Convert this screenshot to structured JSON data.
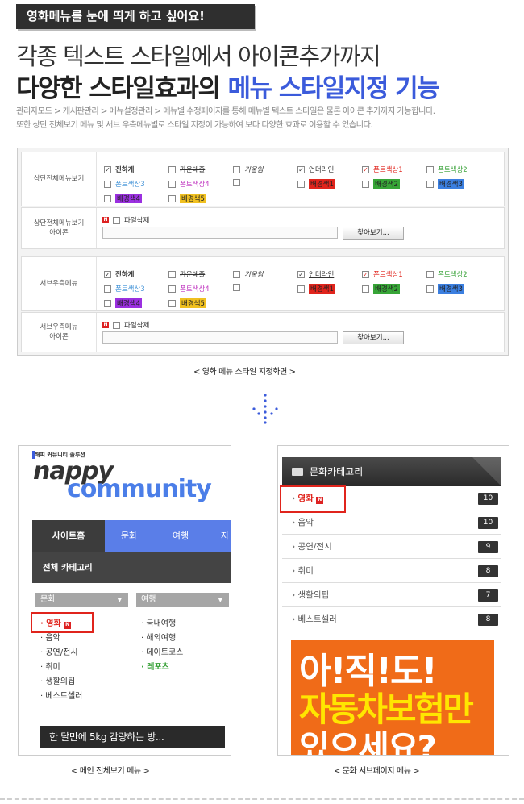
{
  "header": {
    "tag": "영화메뉴를 눈에 띄게 하고 싶어요!",
    "title_line1": "각종 텍스트 스타일에서 아이콘추가까지",
    "title_line2": "다양한 스타일효과의",
    "title_highlight": "메뉴 스타일지정 기능",
    "desc_line1": "관리자모드 > 게시판관리 > 메뉴설정관리 > 메뉴별 수정페이지를 통해 메뉴별 텍스트 스타일은 물론 아이콘 추가까지 가능합니다.",
    "desc_line2": "또한 상단 전체보기 메뉴 및 서브 우측메뉴별로 스타일 지정이 가능하여 보다 다양한 효과로 이용할 수 있습니다."
  },
  "style_panel": {
    "sections": [
      {
        "label": "상단전체메뉴보기"
      },
      {
        "label": "상단전체메뉴보기\n아이콘"
      },
      {
        "label": "서브우측메뉴"
      },
      {
        "label": "서브우측메뉴\n아이콘"
      }
    ],
    "options": {
      "bold": "진하게",
      "strike": "가운데줄",
      "italic": "기울임",
      "underline": "언더라인",
      "fc1": "폰트색상1",
      "fc2": "폰트색상2",
      "fc3": "폰트색상3",
      "fc4": "폰트색상4",
      "bg1": "배경색1",
      "bg2": "배경색2",
      "bg3": "배경색3",
      "bg4": "배경색4",
      "bg5": "배경색5"
    },
    "delete_file": "파일삭제",
    "find_button": "찾아보기...",
    "caption": "< 영화 메뉴 스타일 지정화면 >"
  },
  "colors": {
    "accent_blue": "#3b5bdb",
    "highlight_red": "#e0241c",
    "fc1": "#e0241c",
    "fc2": "#35a035",
    "fc3": "#3b8fd6",
    "fc4": "#c036c0",
    "bg1": "#e0241c",
    "bg2": "#37a537",
    "bg3": "#3b7fe0",
    "bg4": "#9b30e0",
    "bg5": "#f0c020"
  },
  "main_menu": {
    "logo_tagline": "해피 커뮤니티 솔루션",
    "logo_word1": "nappy",
    "logo_word2": "community",
    "nav": [
      "사이트홈",
      "문화",
      "여행",
      "자"
    ],
    "category_header": "전체 카테고리",
    "col1_title": "문화",
    "col2_title": "여행",
    "col1_items": [
      "영화",
      "음악",
      "공연/전시",
      "취미",
      "생활의팁",
      "베스트셀러"
    ],
    "col2_items": [
      "국내여행",
      "해외여행",
      "데이트코스",
      "레포츠"
    ],
    "banner": "한 달만에 5kg 감량하는 방...",
    "caption": "< 메인 전체보기 메뉴 >"
  },
  "sub_menu": {
    "title": "문화카테고리",
    "items": [
      {
        "label": "영화",
        "count": "10"
      },
      {
        "label": "음악",
        "count": "10"
      },
      {
        "label": "공연/전시",
        "count": "9"
      },
      {
        "label": "취미",
        "count": "8"
      },
      {
        "label": "생활의팁",
        "count": "7"
      },
      {
        "label": "베스트셀러",
        "count": "8"
      }
    ],
    "ad_line1": "아!직!도!",
    "ad_line2": "자동차보험만",
    "ad_line3": "있으세요?",
    "caption": "< 문화 서브페이지 메뉴 >"
  },
  "new_badge": "N"
}
